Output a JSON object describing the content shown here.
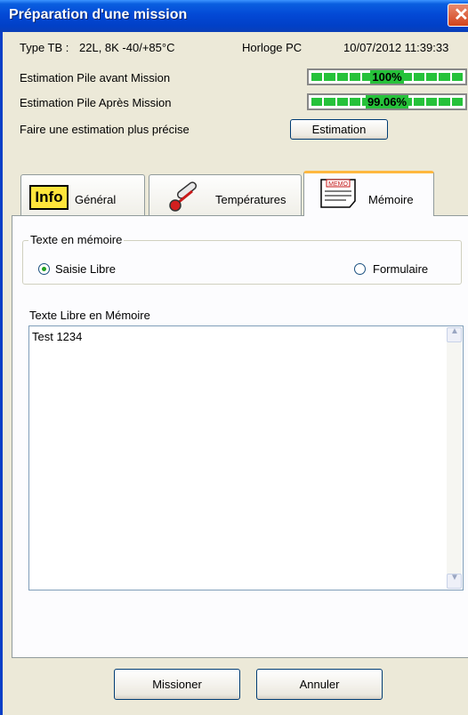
{
  "window": {
    "title": "Préparation d'une mission",
    "close": "✕"
  },
  "info": {
    "type_label": "Type TB :",
    "type_value": "22L, 8K -40/+85°C",
    "clock_label": "Horloge PC",
    "clock_value": "10/07/2012 11:39:33"
  },
  "battery": {
    "before_label": "Estimation Pile avant Mission",
    "before_pct": "100%",
    "before_level": 1.0,
    "after_label": "Estimation Pile Après Mission",
    "after_pct": "99.06%",
    "after_level": 0.99
  },
  "estimation": {
    "label": "Faire une estimation plus précise",
    "button": "Estimation"
  },
  "tabs": [
    {
      "label": "Général",
      "icon": "info-icon"
    },
    {
      "label": "Températures",
      "icon": "thermometer-icon"
    },
    {
      "label": "Mémoire",
      "icon": "memo-icon",
      "icon_text": "MEMO",
      "active": true
    }
  ],
  "memory": {
    "group_title": "Texte en mémoire",
    "option_free": "Saisie Libre",
    "option_form": "Formulaire",
    "selected": "Saisie Libre",
    "text_label": "Texte Libre en Mémoire",
    "text_value": "Test 1234"
  },
  "footer": {
    "ok": "Missioner",
    "cancel": "Annuler"
  },
  "colors": {
    "gauge": "#26c23a",
    "titlebar": "#0349d6",
    "active_tab": "#ffb83f"
  }
}
